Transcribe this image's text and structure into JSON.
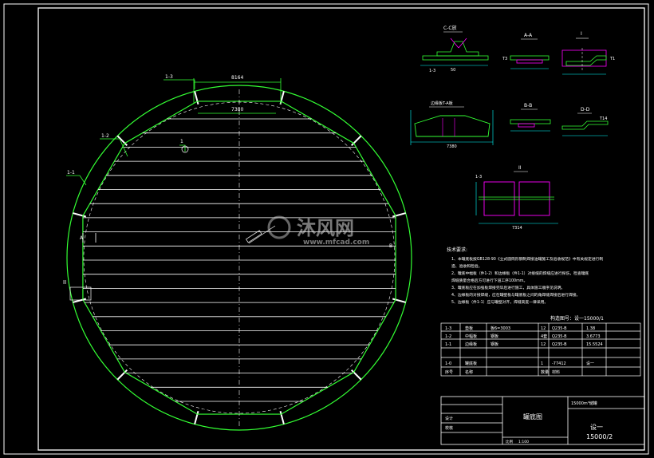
{
  "colors": {
    "background": "#000000",
    "frame": "#ffffff",
    "outline": "#33ff33",
    "dimension": "#00ffff",
    "highlight": "#ff00ff",
    "text": "#ffffff"
  },
  "main_view": {
    "dim_top_outer": "8164",
    "dim_top_inner": "7380",
    "label_13": "1-3",
    "label_12": "1-2",
    "label_11": "1-1",
    "label_1": "1",
    "detail_II": "II",
    "mark_A": "A",
    "mark_B": "B"
  },
  "section_views": {
    "cc_title": "C-C放",
    "cc_label_13": "1-3",
    "cc_dim": "50",
    "aa_title": "A-A",
    "aa_label": "T3",
    "i_title": "I",
    "i_label": "T1",
    "edge_title": "边缘板T-A板",
    "edge_dim": "7380",
    "bb_title": "B-B",
    "dd_title": "D-D",
    "dd_label": "T14",
    "ii_title": "II",
    "ii_label": "1-3",
    "ii_dim": "7314"
  },
  "watermark": {
    "name": "沐风网",
    "url": "www.mfcad.com"
  },
  "notes": {
    "title": "技术要求:",
    "lines": [
      "1、本罐底板按GB128-90《立式圆筒形钢制焊接油罐施工及验收规范》中有关规定进行制",
      "造、验收和检验。",
      "2、罐底中幅板（件1-2）和边缘板（件1-1）对接缝的焊缝应进行探伤，检查罐底",
      "焊缝质量合格后方可进行下道工序100mm。",
      "3、罐底板应在加强板焊接完毕后进行施工，具体施工顺序见说明。",
      "4、边缘板的对接焊缝，应在罐壁板与罐底板之间的角焊缝焊接后进行焊接。",
      "5、边缘板（件1-1）应与罐壁对齐，焊缝高度一律采用。"
    ]
  },
  "drawing_no": "构造图号：设一15000/1",
  "parts_table": {
    "rows": [
      {
        "no": "1-3",
        "name": "垫板",
        "spec": "板6=3003",
        "qty": "12",
        "mat": "Q235-B",
        "mass": "1.38",
        "total": ""
      },
      {
        "no": "1-2",
        "name": "中幅板",
        "spec": "钢板",
        "qty": "4套",
        "mat": "Q235-B",
        "mass": "3.6773",
        "total": ""
      },
      {
        "no": "1-1",
        "name": "边缘板",
        "spec": "钢板",
        "qty": "12",
        "mat": "Q235-B",
        "mass": "15.5524",
        "total": ""
      }
    ],
    "subtotal_row": {
      "no": "1-0",
      "name": "罐底板",
      "spec": "",
      "qty": "1",
      "mat": "-77412",
      "mass": "",
      "total": "设一"
    },
    "header": {
      "no": "序号",
      "name": "名称",
      "qty": "数量",
      "mat": "材料"
    }
  },
  "title_block": {
    "drawing_name": "罐底图",
    "project": "15000m³储罐",
    "design_label": "设计",
    "check_label": "校核",
    "drawing_code": "设一",
    "sheet_code": "15000/2",
    "scale_label": "比例",
    "scale_value": "1:100"
  }
}
